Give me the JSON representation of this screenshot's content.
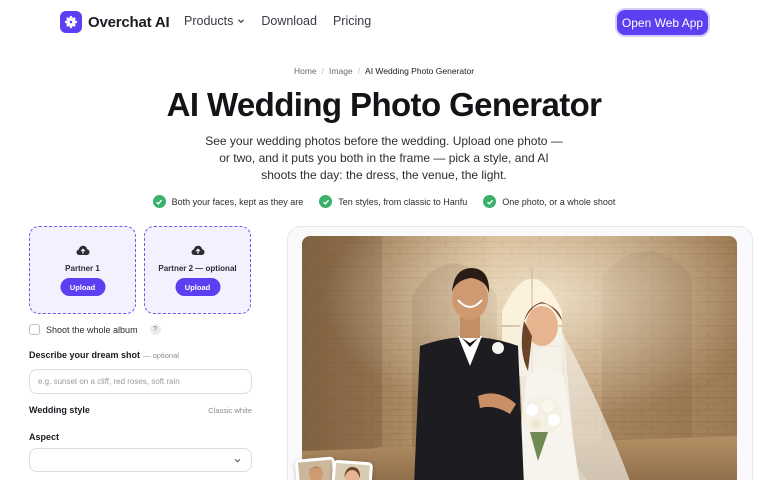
{
  "nav": {
    "logo_text": "Overchat AI",
    "links": [
      {
        "label": "Products",
        "has_dropdown": true
      },
      {
        "label": "Download"
      },
      {
        "label": "Pricing"
      }
    ],
    "cta": "Open Web App"
  },
  "breadcrumb": [
    "Home",
    "Image",
    "AI Wedding Photo Generator"
  ],
  "hero": {
    "title": "AI Wedding Photo Generator",
    "subtitle": "See your wedding photos before the wedding. Upload one photo — or two, and it puts you both in the frame — pick a style, and AI shoots the day: the dress, the venue, the light."
  },
  "features": [
    "Both your faces, kept as they are",
    "Ten styles, from classic to Hanfu",
    "One photo, or a whole shoot"
  ],
  "uploads": [
    {
      "label": "Partner 1",
      "button": "Upload"
    },
    {
      "label": "Partner 2 — optional",
      "button": "Upload"
    }
  ],
  "album": {
    "label": "Shoot the whole album",
    "checked": false,
    "help": "?"
  },
  "describe": {
    "label": "Describe your dream shot",
    "optional": "— optional",
    "placeholder": "e.g. sunset on a cliff, red roses, soft rain"
  },
  "style": {
    "label": "Wedding style",
    "value": "Classic white"
  },
  "aspect": {
    "label": "Aspect",
    "value": ""
  },
  "colors": {
    "accent": "#5b3ff0",
    "check": "#3bb06a",
    "upload_bg": "#f4f1ff"
  },
  "icons": {
    "logo": "asterisk-flower-icon",
    "upload": "cloud-upload-icon",
    "check": "check-circle-icon",
    "dropdown": "chevron-down-icon"
  }
}
